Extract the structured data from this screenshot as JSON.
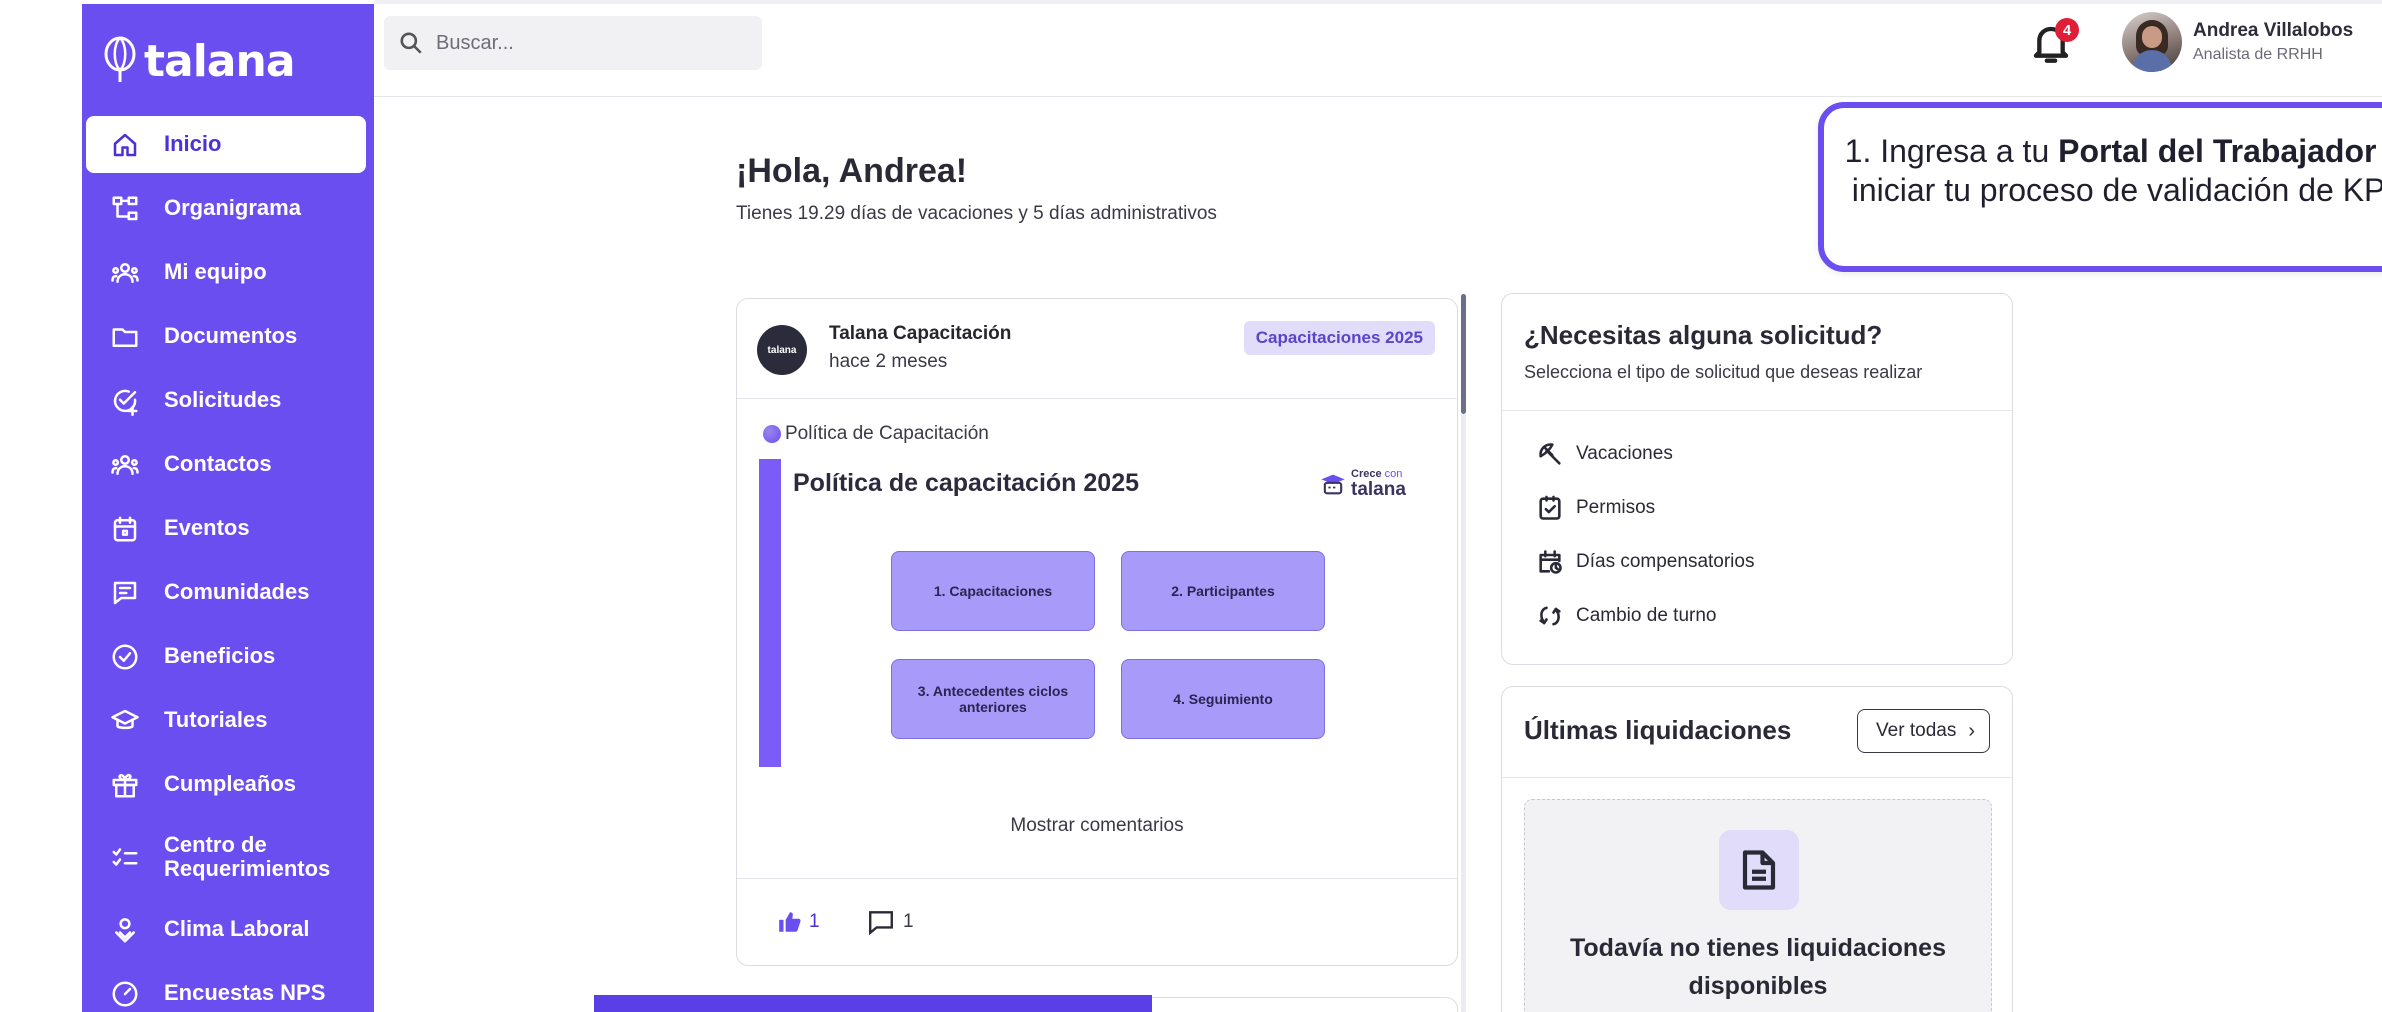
{
  "app": {
    "brand": "talana"
  },
  "search": {
    "placeholder": "Buscar..."
  },
  "notifications": {
    "count": "4"
  },
  "user": {
    "name": "Andrea Villalobos",
    "role": "Analista de RRHH"
  },
  "sidebar": {
    "items": [
      {
        "label": "Inicio",
        "icon": "home-icon",
        "active": true
      },
      {
        "label": "Organigrama",
        "icon": "org-chart-icon"
      },
      {
        "label": "Mi equipo",
        "icon": "team-icon"
      },
      {
        "label": "Documentos",
        "icon": "folder-icon"
      },
      {
        "label": "Solicitudes",
        "icon": "request-icon"
      },
      {
        "label": "Contactos",
        "icon": "contacts-icon"
      },
      {
        "label": "Eventos",
        "icon": "calendar-icon"
      },
      {
        "label": "Comunidades",
        "icon": "community-icon"
      },
      {
        "label": "Beneficios",
        "icon": "check-circle-icon"
      },
      {
        "label": "Tutoriales",
        "icon": "graduation-cap-icon"
      },
      {
        "label": "Cumpleaños",
        "icon": "gift-icon"
      },
      {
        "label": "Centro de Requerimientos",
        "icon": "checklist-icon"
      },
      {
        "label": "Clima Laboral",
        "icon": "mood-icon"
      },
      {
        "label": "Encuestas NPS",
        "icon": "gauge-icon"
      }
    ]
  },
  "main": {
    "greeting": "¡Hola, Andrea!",
    "subtitle": "Tienes 19.29 días de vacaciones y 5 días administrativos"
  },
  "post": {
    "author": "Talana Capacitación",
    "time": "hace 2 meses",
    "avatar_text": "talana",
    "tag": "Capacitaciones 2025",
    "topic": "Política de Capacitación",
    "slide_title": "Política de capacitación 2025",
    "slide_logo_top": "Crece",
    "slide_logo_top2": "con",
    "slide_logo_bottom": "talana",
    "boxes": [
      "1.    Capacitaciones",
      "2. Participantes",
      "3. Antecedentes ciclos anteriores",
      "4. Seguimiento"
    ],
    "show_comments": "Mostrar comentarios",
    "likes": "1",
    "comments": "1"
  },
  "requests": {
    "title": "¿Necesitas alguna solicitud?",
    "subtitle": "Selecciona el tipo de solicitud que deseas realizar",
    "items": [
      {
        "label": "Vacaciones",
        "icon": "beach-umbrella-icon"
      },
      {
        "label": "Permisos",
        "icon": "check-clipboard-icon"
      },
      {
        "label": "Días compensatorios",
        "icon": "calendar-clock-icon"
      },
      {
        "label": "Cambio de turno",
        "icon": "swap-icon"
      }
    ]
  },
  "payroll": {
    "title": "Últimas liquidaciones",
    "button": "Ver todas",
    "empty": "Todavía no tienes liquidaciones disponibles"
  },
  "callout": {
    "prefix": "1. Ingresa a tu ",
    "bold1": "Portal del Trabajador",
    "suffix": " y iniciar tu proceso de validación de KPI"
  },
  "colors": {
    "accent": "#6a4ef0",
    "sidebar_bg": "#6a4ef0",
    "badge": "#e01e37",
    "tag_bg": "#e2dcfb"
  }
}
